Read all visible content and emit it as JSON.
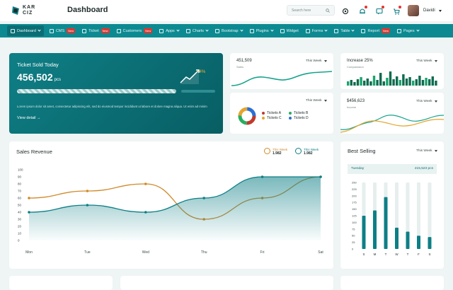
{
  "header": {
    "logo_text_line1": "KAR",
    "logo_text_line2": "CIZ",
    "page_title": "Dashboard",
    "search_placeholder": "Search here",
    "user_name": "Davidi"
  },
  "nav": {
    "items": [
      {
        "label": "Dashboard",
        "active": true,
        "badge": "",
        "dropdown": true
      },
      {
        "label": "CMS",
        "badge": "New",
        "dropdown": false
      },
      {
        "label": "Ticket",
        "badge": "New",
        "dropdown": false
      },
      {
        "label": "Customers",
        "badge": "New",
        "dropdown": false
      },
      {
        "label": "Apps",
        "badge": "",
        "dropdown": true
      },
      {
        "label": "Charts",
        "badge": "",
        "dropdown": true
      },
      {
        "label": "Bootstrap",
        "badge": "",
        "dropdown": true
      },
      {
        "label": "Plugins",
        "badge": "",
        "dropdown": true
      },
      {
        "label": "Widget",
        "badge": "",
        "dropdown": false
      },
      {
        "label": "Forms",
        "badge": "",
        "dropdown": true
      },
      {
        "label": "Table",
        "badge": "",
        "dropdown": true
      },
      {
        "label": "Report",
        "badge": "New",
        "dropdown": false
      },
      {
        "label": "Pages",
        "badge": "",
        "dropdown": true
      }
    ]
  },
  "ticket_card": {
    "title": "Ticket Sold Today",
    "value": "456,502",
    "unit": "pcs",
    "change": "+4%",
    "description": "Lorem ipsum dolor sit amet, consectetur adipiscing elit, sed do eiusmod tempor incididunt ut labore et dolore magna aliqua. Ut enim ad minim",
    "link": "View detail"
  },
  "sales_card": {
    "value": "451,509",
    "label": "Sales",
    "period": "This Week"
  },
  "increase_card": {
    "value": "Increase 25%",
    "label": "Comparasion",
    "period": "This Week"
  },
  "tickets_card": {
    "period": "This Week",
    "legend": [
      {
        "name": "Tickets A",
        "color": "#c0392b"
      },
      {
        "name": "Tickets B",
        "color": "#27ae60"
      },
      {
        "name": "Tickets C",
        "color": "#e5a52d"
      },
      {
        "name": "Tickets D",
        "color": "#2e6fd0"
      }
    ]
  },
  "income_card": {
    "value": "$456,623",
    "label": "Income",
    "period": "This Week"
  },
  "sales_revenue": {
    "title": "Sales Revenue",
    "legend": [
      {
        "label": "This Week",
        "value": "1.982",
        "color": "#d08a2a"
      },
      {
        "label": "This Week",
        "value": "1.982",
        "color": "#0d7f86"
      }
    ]
  },
  "best_selling": {
    "title": "Best Selling",
    "period": "This Week",
    "day": "Tuesday",
    "day_value": "215,523 pcs"
  },
  "chart_data": [
    {
      "type": "line",
      "title": "Sales Revenue",
      "x": [
        "Mon",
        "Tue",
        "Wed",
        "Thu",
        "Fri",
        "Sat"
      ],
      "series": [
        {
          "name": "This Week",
          "values": [
            60,
            70,
            80,
            30,
            60,
            90
          ],
          "color": "#d08a2a"
        },
        {
          "name": "This Week",
          "values": [
            40,
            50,
            40,
            60,
            90,
            90
          ],
          "color": "#0d7f86"
        }
      ],
      "yticks": [
        0,
        10,
        20,
        30,
        40,
        50,
        60,
        70,
        80,
        90,
        100
      ],
      "ylim": [
        0,
        100
      ]
    },
    {
      "type": "bar",
      "title": "Best Selling",
      "categories": [
        "S",
        "M",
        "T",
        "W",
        "T",
        "F",
        "S"
      ],
      "values": [
        125,
        145,
        195,
        80,
        65,
        50,
        45
      ],
      "ylim": [
        0,
        250
      ],
      "yticks": [
        0,
        25,
        50,
        75,
        100,
        125,
        150,
        175,
        200,
        225,
        250
      ]
    }
  ]
}
